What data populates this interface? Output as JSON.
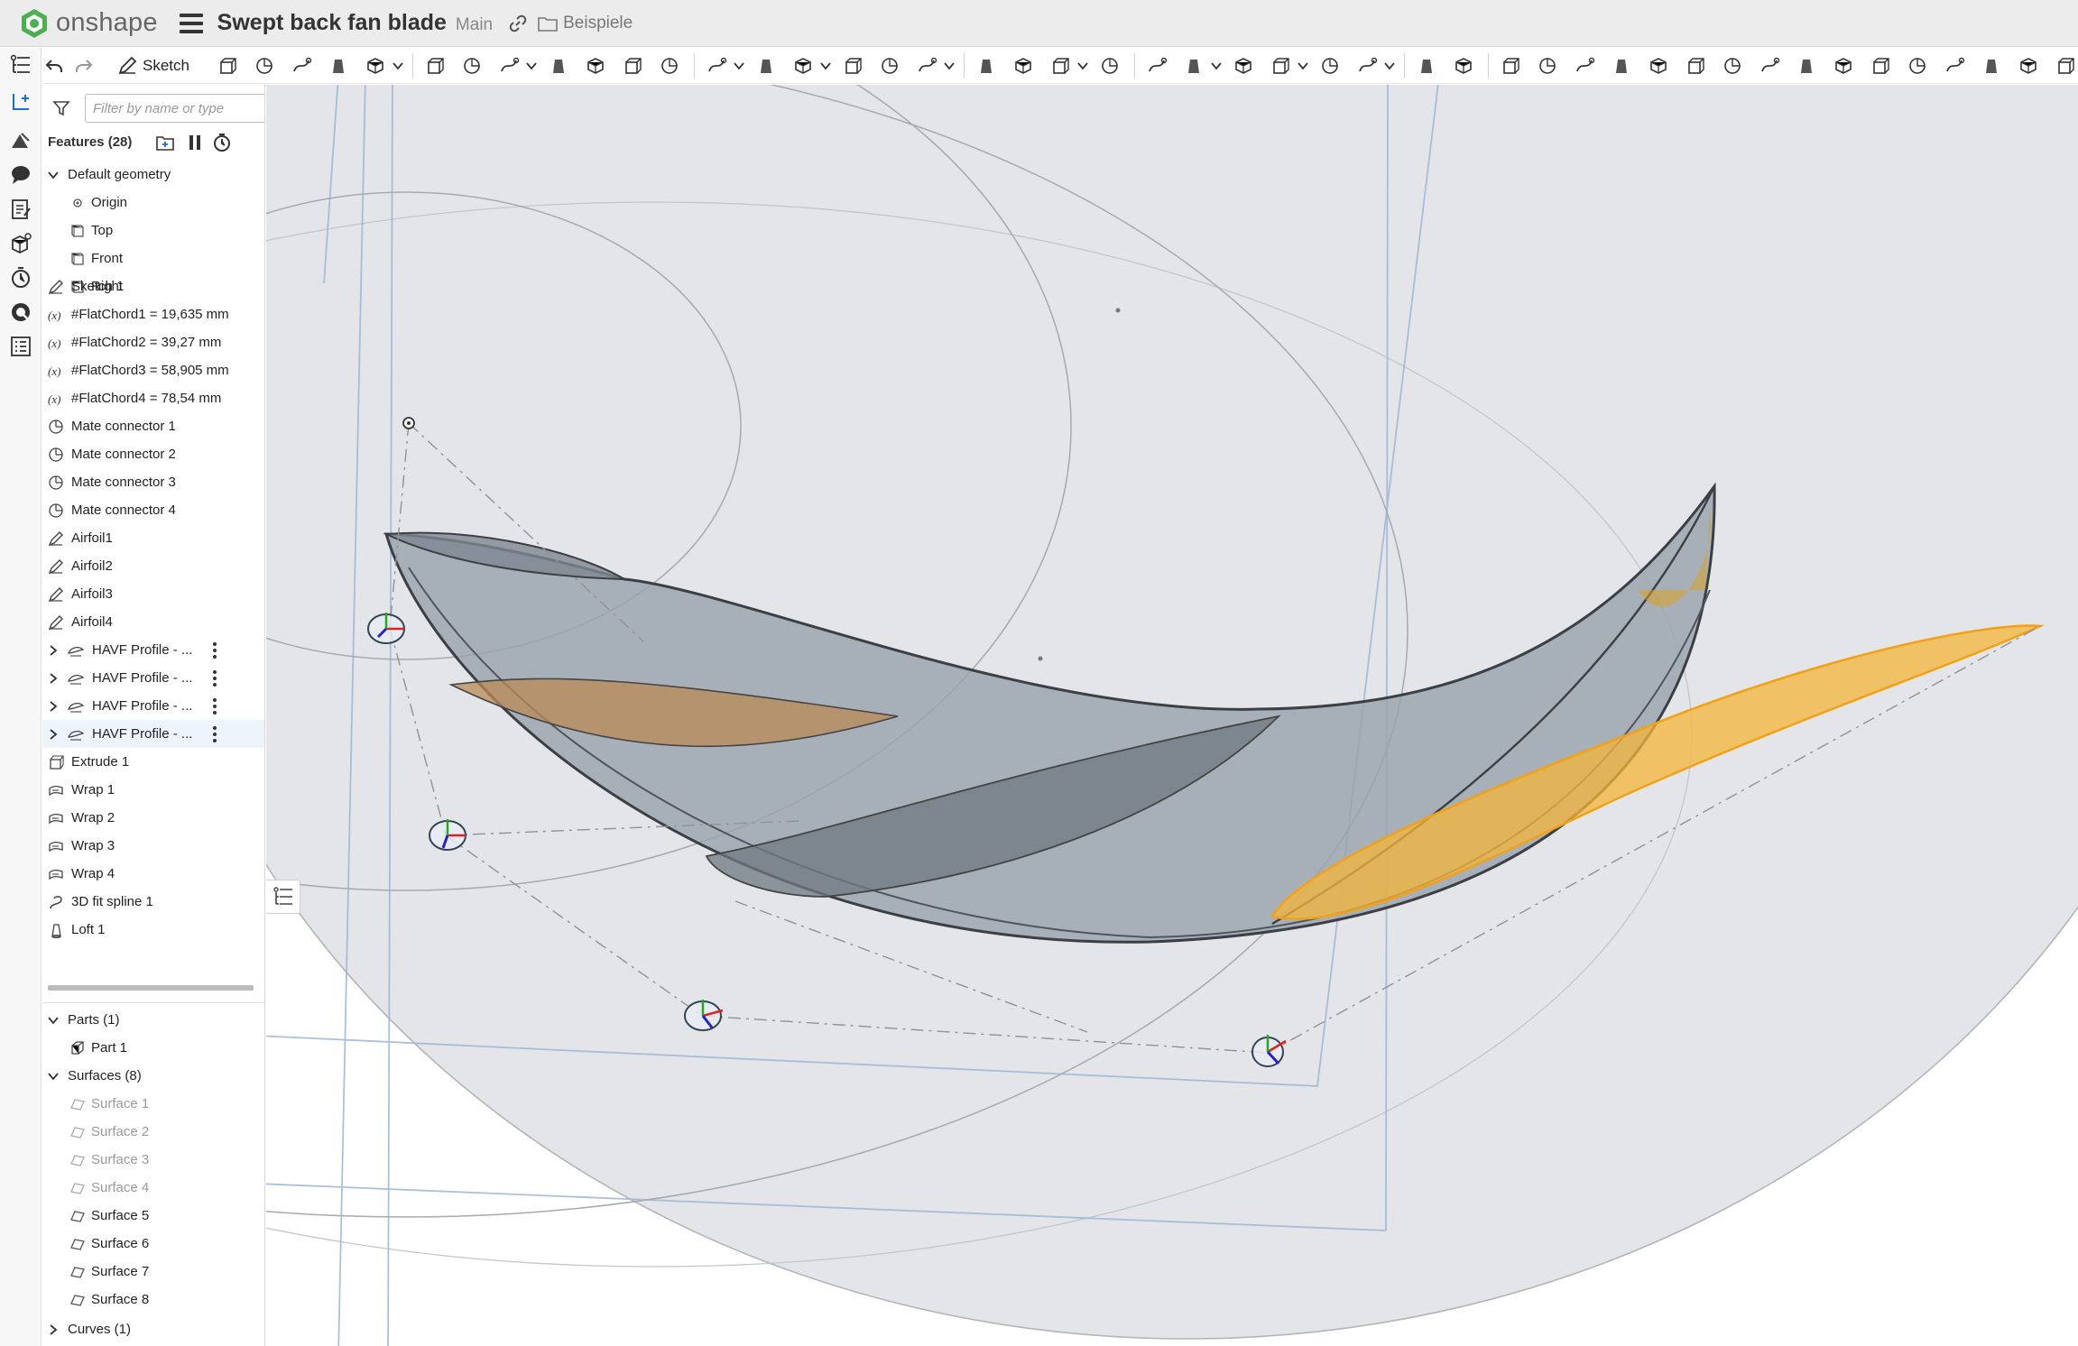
{
  "app": {
    "name": "onshape",
    "document_title": "Swept back fan blade",
    "branch": "Main",
    "folder": "Beispiele",
    "brand_color": "#4caf50"
  },
  "toolbar": {
    "sketch_label": "Sketch",
    "left_buttons": [
      "undo-icon",
      "redo-icon"
    ],
    "tools": [
      "extrude-icon",
      "revolve-icon",
      "sweep-icon",
      "loft-icon",
      "thicken-icon",
      "fillet-icon",
      "chamfer-icon",
      "draft-icon",
      "rib-icon",
      "shell-icon",
      "hole-icon",
      "cylinder-icon",
      "pattern-icon",
      "mirror-icon",
      "boolean-icon",
      "split-icon",
      "transform-icon",
      "delete-part-icon",
      "modify-fillet-icon",
      "delete-face-icon",
      "move-face-icon",
      "replace-face-icon",
      "plane-icon",
      "mate-connector-icon",
      "helix-icon",
      "spline-icon",
      "fit-spline-icon",
      "variable-icon",
      "configurations-icon",
      "tag-icon",
      "sheet-metal-icon",
      "sheet-metal-flange-icon",
      "sheet-metal-tab-icon",
      "sheet-metal-bend-icon",
      "sheet-metal-corner-icon",
      "sheet-metal-flat-icon",
      "frame-icon",
      "frame-trim-icon",
      "gusset-icon",
      "end-cap-icon",
      "cut-list-icon",
      "surface-icon",
      "ruled-surface-icon",
      "boundary-surface-icon",
      "fill-icon",
      "extend-icon",
      "offset-curve-icon"
    ]
  },
  "feature_panel": {
    "filter_placeholder": "Filter by name or type",
    "features_title": "Features (28)",
    "default_geometry": "Default geometry",
    "origin": "Origin",
    "planes": [
      "Top",
      "Front",
      "Right"
    ],
    "sketch1": "Sketch 1",
    "variables": [
      "#FlatChord1 = 19,635 mm",
      "#FlatChord2 = 39,27 mm",
      "#FlatChord3 = 58,905 mm",
      "#FlatChord4 = 78,54 mm"
    ],
    "mate_connectors": [
      "Mate connector 1",
      "Mate connector 2",
      "Mate connector 3",
      "Mate connector 4"
    ],
    "airfoils": [
      "Airfoil1",
      "Airfoil2",
      "Airfoil3",
      "Airfoil4"
    ],
    "havf_profiles": [
      "HAVF Profile - ...",
      "HAVF Profile - ...",
      "HAVF Profile - ...",
      "HAVF Profile - ..."
    ],
    "extrude": "Extrude 1",
    "wraps": [
      "Wrap 1",
      "Wrap 2",
      "Wrap 3",
      "Wrap 4"
    ],
    "fit_spline": "3D fit spline 1",
    "loft": "Loft 1",
    "parts_header": "Parts (1)",
    "part1": "Part 1",
    "surfaces_header": "Surfaces (8)",
    "surfaces": [
      "Surface 1",
      "Surface 2",
      "Surface 3",
      "Surface 4",
      "Surface 5",
      "Surface 6",
      "Surface 7",
      "Surface 8"
    ],
    "surfaces_hidden_count": 4,
    "curves_header": "Curves (1)",
    "selected_item": "HAVF Profile - ... (4)"
  },
  "viewport": {
    "highlight_color": "#f5b53a",
    "body_color": "#9aa3ad",
    "background": "#ffffff"
  }
}
